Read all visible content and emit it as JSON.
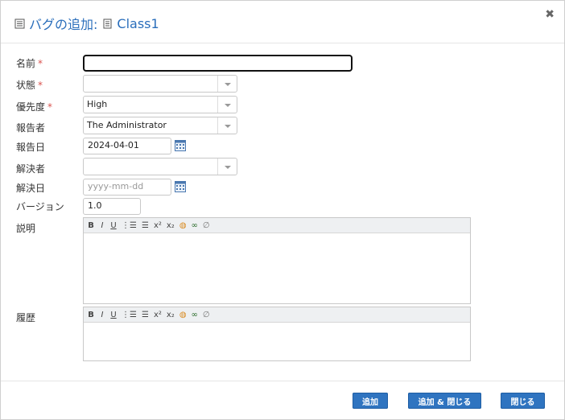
{
  "dialog": {
    "title": "バグの追加:",
    "class_name": "Class1",
    "close_glyph": "✖"
  },
  "fields": {
    "name": {
      "label": "名前",
      "required": "*",
      "value": ""
    },
    "status": {
      "label": "状態",
      "required": "*",
      "value": ""
    },
    "priority": {
      "label": "優先度",
      "required": "*",
      "value": "High"
    },
    "reporter": {
      "label": "報告者",
      "value": "The Administrator"
    },
    "report_date": {
      "label": "報告日",
      "value": "2024-04-01"
    },
    "resolver": {
      "label": "解決者",
      "value": ""
    },
    "resolve_date": {
      "label": "解決日",
      "placeholder": "yyyy-mm-dd"
    },
    "version": {
      "label": "バージョン",
      "value": "1.0"
    },
    "description": {
      "label": "説明"
    },
    "history": {
      "label": "履歴"
    }
  },
  "toolbar": {
    "bold": "B",
    "italic": "I",
    "underline": "U",
    "ordered_list": "⋮☰",
    "unordered_list": "☰",
    "superscript": "x²",
    "subscript": "x₂",
    "clear_format": "◍",
    "link": "∞",
    "unlink": "∅"
  },
  "buttons": {
    "add": "追加",
    "add_close": "追加 & 閉じる",
    "close": "閉じる"
  },
  "colors": {
    "title": "#2a6ebb",
    "button": "#2f74c0",
    "required": "#d9534f"
  }
}
